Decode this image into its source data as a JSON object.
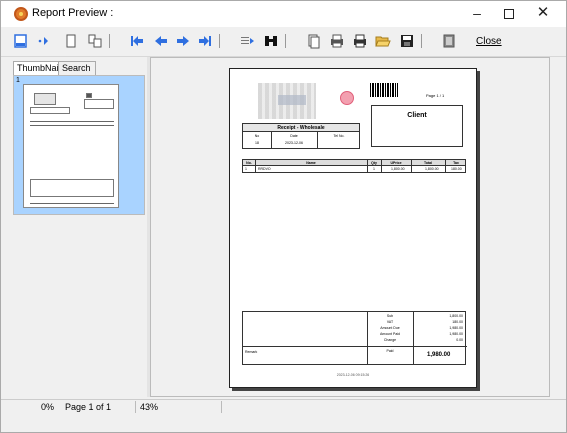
{
  "window": {
    "title": "Report Preview :"
  },
  "toolbar": {
    "close_label": "Close"
  },
  "tabs": [
    {
      "label": "ThumbNails"
    },
    {
      "label": "Search Results"
    }
  ],
  "thumbnail": {
    "number": "1"
  },
  "page": {
    "page_indicator": "Page  1  /  1",
    "client_label": "Client",
    "receipt_title": "Receipt - Wholesale",
    "receipt_headers": [
      "No",
      "Date",
      "Tel No."
    ],
    "receipt_values": [
      "18",
      "2023-12-06",
      ""
    ],
    "items": {
      "headers": [
        "No.",
        "Name",
        "Qty",
        "UPrice",
        "Total",
        "Tax"
      ],
      "rows": [
        [
          "1",
          "RRDVO",
          "1",
          "1,800.00",
          "1,800.00",
          "180.00"
        ]
      ]
    },
    "totals": {
      "labels": [
        "Sub",
        "VAT",
        "Amount Due",
        "Amount Paid",
        "Change"
      ],
      "values": [
        "1,800.00",
        "180.00",
        "1,980.00",
        "1,980.00",
        "0.00"
      ],
      "paid_label": "Paid",
      "paid_value": "1,980.00",
      "remark_label": "Remark"
    },
    "footer": "2023-12-06 09:15:26"
  },
  "status": {
    "progress": "0%",
    "page_info": "Page 1 of 1",
    "zoom": "43%"
  },
  "colors": {
    "accent_arrow": "#2f6fe0",
    "thumb_selected": "#a9d3ff"
  }
}
